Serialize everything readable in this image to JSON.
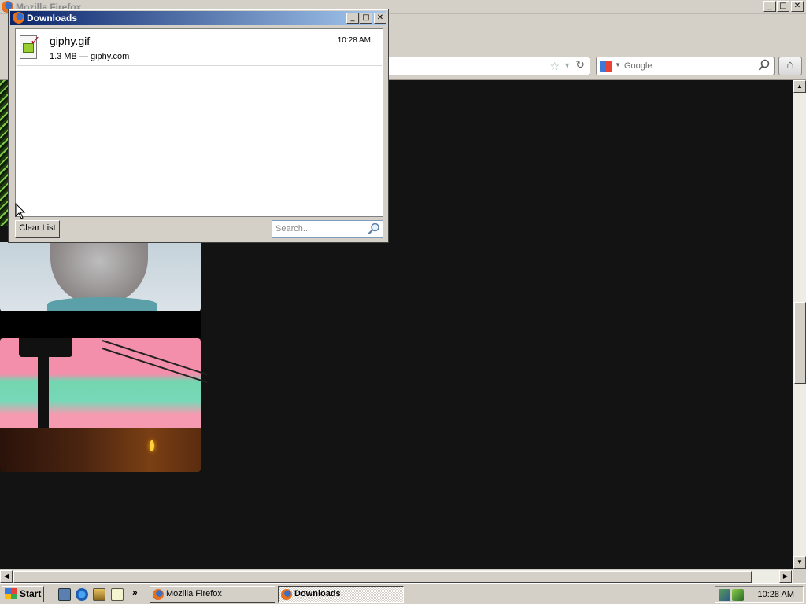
{
  "browser": {
    "title": "Mozilla Firefox",
    "search_engine": "Google",
    "controls": {
      "minimize": "_",
      "maximize": "□",
      "close": "✕"
    }
  },
  "downloads": {
    "title": "Downloads",
    "items": [
      {
        "filename": "giphy.gif",
        "details": "1.3 MB — giphy.com",
        "time": "10:28 AM"
      }
    ],
    "clear_label": "Clear List",
    "search_placeholder": "Search...",
    "controls": {
      "minimize": "_",
      "maximize": "□",
      "close": "✕"
    }
  },
  "scrollbars": {
    "up": "▲",
    "down": "▼",
    "left": "◀",
    "right": "▶"
  },
  "taskbar": {
    "start_label": "Start",
    "more": "»",
    "tasks": [
      {
        "label": "Mozilla Firefox",
        "active": false
      },
      {
        "label": "Downloads",
        "active": true
      }
    ],
    "clock": "10:28 AM"
  },
  "colors": {
    "titlebar_active_start": "#0a246a",
    "titlebar_active_end": "#a6caf0",
    "content_bg": "#131313",
    "chrome_bg": "#d4d0c8"
  }
}
